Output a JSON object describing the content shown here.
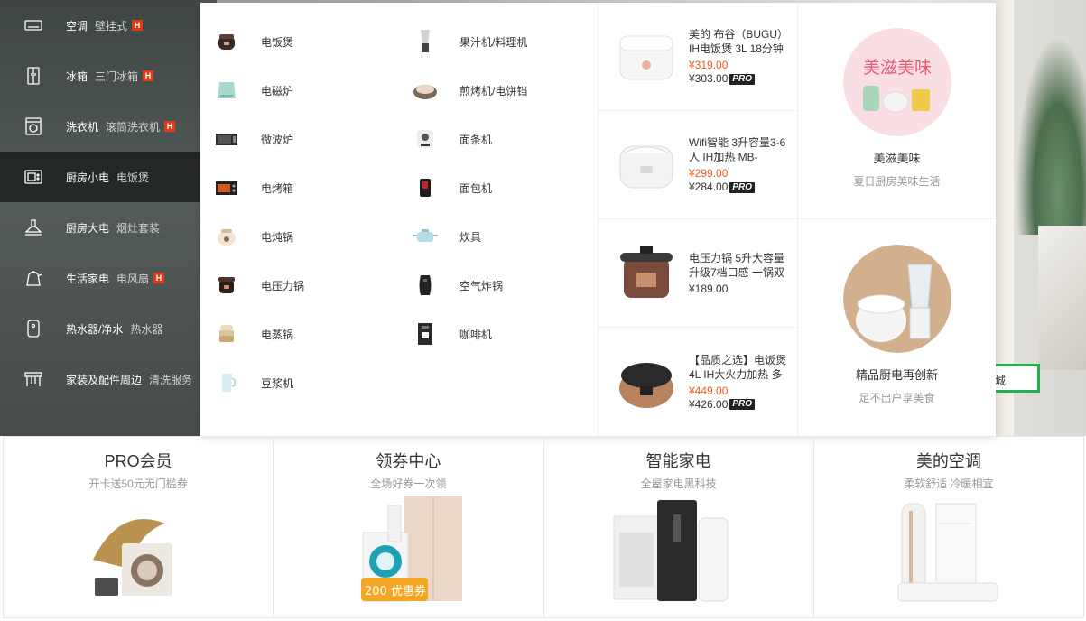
{
  "categories": [
    {
      "name": "空调",
      "sub": "壁挂式",
      "hot": "H",
      "icon": "air-conditioner-icon"
    },
    {
      "name": "冰箱",
      "sub": "三门冰箱",
      "hot": "H",
      "icon": "fridge-icon"
    },
    {
      "name": "洗衣机",
      "sub": "滚筒洗衣机",
      "hot": "H",
      "icon": "washing-machine-icon"
    },
    {
      "name": "厨房小电",
      "sub": "电饭煲",
      "hot": "",
      "icon": "microwave-icon",
      "active": true
    },
    {
      "name": "厨房大电",
      "sub": "烟灶套装",
      "hot": "",
      "icon": "range-hood-icon"
    },
    {
      "name": "生活家电",
      "sub": "电风扇",
      "hot": "H",
      "icon": "kettle-icon"
    },
    {
      "name": "热水器/净水",
      "sub": "热水器",
      "hot": "",
      "icon": "water-heater-icon"
    },
    {
      "name": "家装及配件周边",
      "sub": "清洗服务",
      "hot": "",
      "icon": "cabinet-icon"
    }
  ],
  "subcategories_left": [
    "电饭煲",
    "电磁炉",
    "微波炉",
    "电烤箱",
    "电炖锅",
    "电压力锅",
    "电蒸锅",
    "豆浆机"
  ],
  "subcategories_right": [
    "果汁机/料理机",
    "煎烤机/电饼铛",
    "面条机",
    "面包机",
    "炊具",
    "空气炸锅",
    "咖啡机"
  ],
  "products": [
    {
      "name": "美的 布谷（BUGU）IH电饭煲 3L 18分钟",
      "old_price": "¥319.00",
      "price": "¥303.00",
      "pro": "PRO"
    },
    {
      "name": "Wifi智能 3升容量3-6人 IH加热 MB-",
      "old_price": "¥299.00",
      "price": "¥284.00",
      "pro": "PRO"
    },
    {
      "name": "电压力锅 5升大容量 升级7档口感 一锅双",
      "old_price": "",
      "price": "¥189.00",
      "pro": ""
    },
    {
      "name": "【品质之选】电饭煲 4L IH大火力加热 多",
      "old_price": "¥449.00",
      "price": "¥426.00",
      "pro": "PRO"
    }
  ],
  "promos": [
    {
      "badge": "美滋美味",
      "title": "美滋美味",
      "sub": "夏日厨房美味生活"
    },
    {
      "badge": "",
      "title": "精品厨电再创新",
      "sub": "足不出户享美食"
    }
  ],
  "banner_cta": "城",
  "cards": [
    {
      "title": "PRO会员",
      "sub": "开卡送50元无门槛券",
      "badge": ""
    },
    {
      "title": "领券中心",
      "sub": "全场好券一次领",
      "badge": "200 优惠券"
    },
    {
      "title": "智能家电",
      "sub": "全屋家电黑科技",
      "badge": ""
    },
    {
      "title": "美的空调",
      "sub": "柔软舒适 冷暖相宜",
      "badge": ""
    }
  ]
}
